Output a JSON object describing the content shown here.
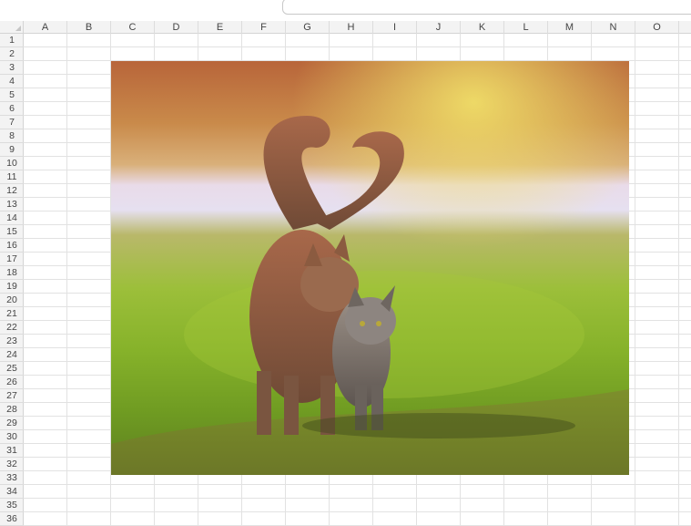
{
  "sheet": {
    "columns": [
      "A",
      "B",
      "C",
      "D",
      "E",
      "F",
      "G",
      "H",
      "I",
      "J",
      "K",
      "L",
      "M",
      "N",
      "O"
    ],
    "rows": [
      "1",
      "2",
      "3",
      "4",
      "5",
      "6",
      "7",
      "8",
      "9",
      "10",
      "11",
      "12",
      "13",
      "14",
      "15",
      "16",
      "17",
      "18",
      "19",
      "20",
      "21",
      "22",
      "23",
      "24",
      "25",
      "26",
      "27",
      "28",
      "29",
      "30",
      "31",
      "32",
      "33",
      "34",
      "35",
      "36"
    ]
  },
  "picture": {
    "subject": "two cats walking with tails forming heart shape",
    "icon": "embedded-photo"
  },
  "colors": {
    "header_bg": "#f3f3f3",
    "grid_line": "#e2e2e2",
    "header_text": "#444444"
  }
}
